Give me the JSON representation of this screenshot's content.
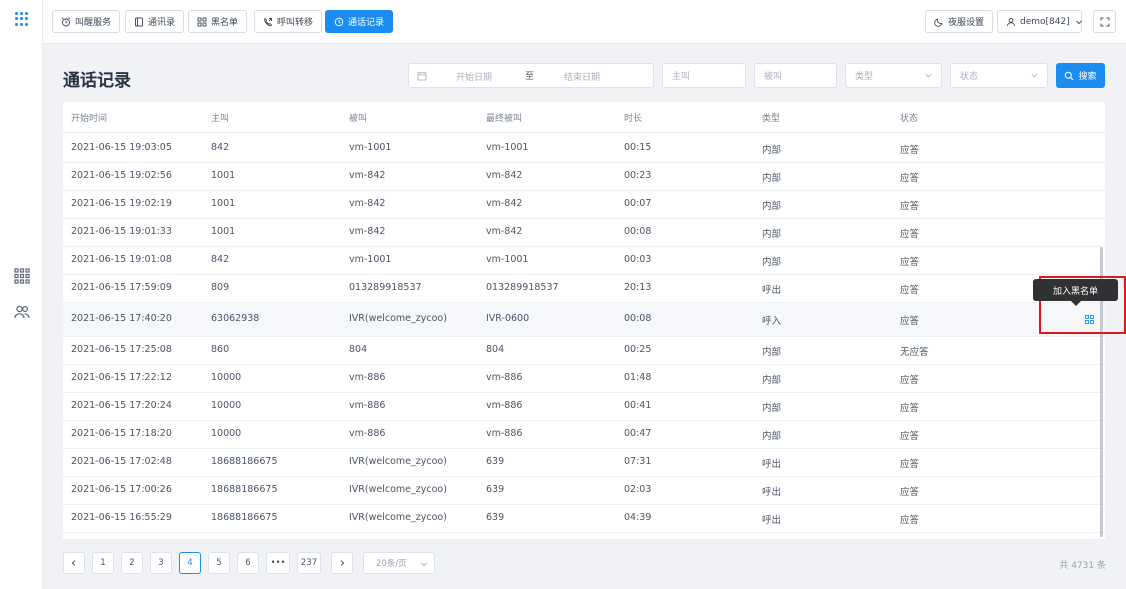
{
  "toolbar": {
    "buttons": [
      {
        "label": "叫醒服务",
        "icon": "alarm-clock-icon"
      },
      {
        "label": "通讯录",
        "icon": "contacts-book-icon"
      },
      {
        "label": "黑名单",
        "icon": "blocklist-grid-icon"
      },
      {
        "label": "呼叫转移",
        "icon": "call-forward-icon"
      },
      {
        "label": "通话记录",
        "icon": "clock-icon",
        "active": true
      }
    ],
    "night_mode": {
      "label": "夜服设置",
      "icon": "moon-icon"
    },
    "user": {
      "label": "demo[842]",
      "icon": "user-icon"
    },
    "fullscreen_icon": "fullscreen-icon"
  },
  "sidebar": {
    "items": [
      {
        "icon": "apps-grid-icon"
      },
      {
        "icon": "users-icon"
      }
    ]
  },
  "page": {
    "title": "通话记录"
  },
  "filters": {
    "start_date_placeholder": "开始日期",
    "date_separator": "至",
    "end_date_placeholder": "结束日期",
    "caller_placeholder": "主叫",
    "callee_placeholder": "被叫",
    "type_placeholder": "类型",
    "status_placeholder": "状态",
    "search_label": "搜索"
  },
  "table": {
    "columns": [
      "开始时间",
      "主叫",
      "被叫",
      "最终被叫",
      "时长",
      "类型",
      "状态"
    ],
    "rows": [
      [
        "2021-06-15 19:03:05",
        "842",
        "vm-1001",
        "vm-1001",
        "00:15",
        "内部",
        "应答"
      ],
      [
        "2021-06-15 19:02:56",
        "1001",
        "vm-842",
        "vm-842",
        "00:23",
        "内部",
        "应答"
      ],
      [
        "2021-06-15 19:02:19",
        "1001",
        "vm-842",
        "vm-842",
        "00:07",
        "内部",
        "应答"
      ],
      [
        "2021-06-15 19:01:33",
        "1001",
        "vm-842",
        "vm-842",
        "00:08",
        "内部",
        "应答"
      ],
      [
        "2021-06-15 19:01:08",
        "842",
        "vm-1001",
        "vm-1001",
        "00:03",
        "内部",
        "应答"
      ],
      [
        "2021-06-15 17:59:09",
        "809",
        "013289918537",
        "013289918537",
        "20:13",
        "呼出",
        "应答"
      ],
      [
        "2021-06-15 17:40:20",
        "63062938",
        "IVR(welcome_zycoo)",
        "IVR-0600",
        "00:08",
        "呼入",
        "应答"
      ],
      [
        "2021-06-15 17:25:08",
        "860",
        "804",
        "804",
        "00:25",
        "内部",
        "无应答"
      ],
      [
        "2021-06-15 17:22:12",
        "10000",
        "vm-886",
        "vm-886",
        "01:48",
        "内部",
        "应答"
      ],
      [
        "2021-06-15 17:20:24",
        "10000",
        "vm-886",
        "vm-886",
        "00:41",
        "内部",
        "应答"
      ],
      [
        "2021-06-15 17:18:20",
        "10000",
        "vm-886",
        "vm-886",
        "00:47",
        "内部",
        "应答"
      ],
      [
        "2021-06-15 17:02:48",
        "18688186675",
        "IVR(welcome_zycoo)",
        "639",
        "07:31",
        "呼出",
        "应答"
      ],
      [
        "2021-06-15 17:00:26",
        "18688186675",
        "IVR(welcome_zycoo)",
        "639",
        "02:03",
        "呼出",
        "应答"
      ],
      [
        "2021-06-15 16:55:29",
        "18688186675",
        "IVR(welcome_zycoo)",
        "639",
        "04:39",
        "呼出",
        "应答"
      ]
    ],
    "hovered_row": 6,
    "row_action": {
      "tooltip": "加入黑名单",
      "icon": "add-to-blocklist-icon"
    }
  },
  "pagination": {
    "pages": [
      "1",
      "2",
      "3",
      "4",
      "5",
      "6",
      "•••",
      "237"
    ],
    "current": "4",
    "page_size": "20条/页",
    "total": "共 4731 条"
  },
  "colors": {
    "accent": "#1d8cf0",
    "highlight_box": "#e01818",
    "tooltip_bg": "#303133"
  }
}
